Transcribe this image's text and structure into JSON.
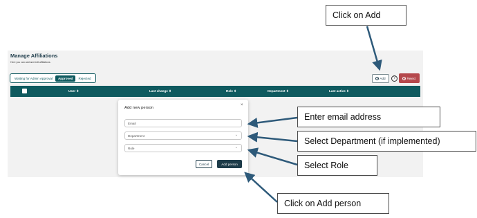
{
  "app": {
    "title": "Manage Affiliations",
    "subtitle": "Here you can add and edit affiliations.",
    "tabs": [
      {
        "label": "Waiting for Admin Approval",
        "active": false
      },
      {
        "label": "Approved",
        "active": true
      },
      {
        "label": "Rejected",
        "active": false
      }
    ],
    "add_button": "Add",
    "add_icon": "plus-circle-icon",
    "help_icon": "question-circle-icon",
    "help_glyph": "?",
    "reject_button": "Reject",
    "reject_icon": "x-circle-icon",
    "columns": [
      "User",
      "Last change",
      "Role",
      "Department",
      "Last active"
    ],
    "accent": "#0f5a5f",
    "reject_color": "#b5484c"
  },
  "modal": {
    "title": "Add new person",
    "close_glyph": "×",
    "email_placeholder": "Email",
    "department_placeholder": "Department",
    "role_placeholder": "Role",
    "cancel_button": "Cancel",
    "submit_button": "Add person"
  },
  "callouts": {
    "add": "Click on Add",
    "email": "Enter email address",
    "department": "Select Department (if implemented)",
    "role": "Select Role",
    "add_person": "Click on Add person"
  }
}
